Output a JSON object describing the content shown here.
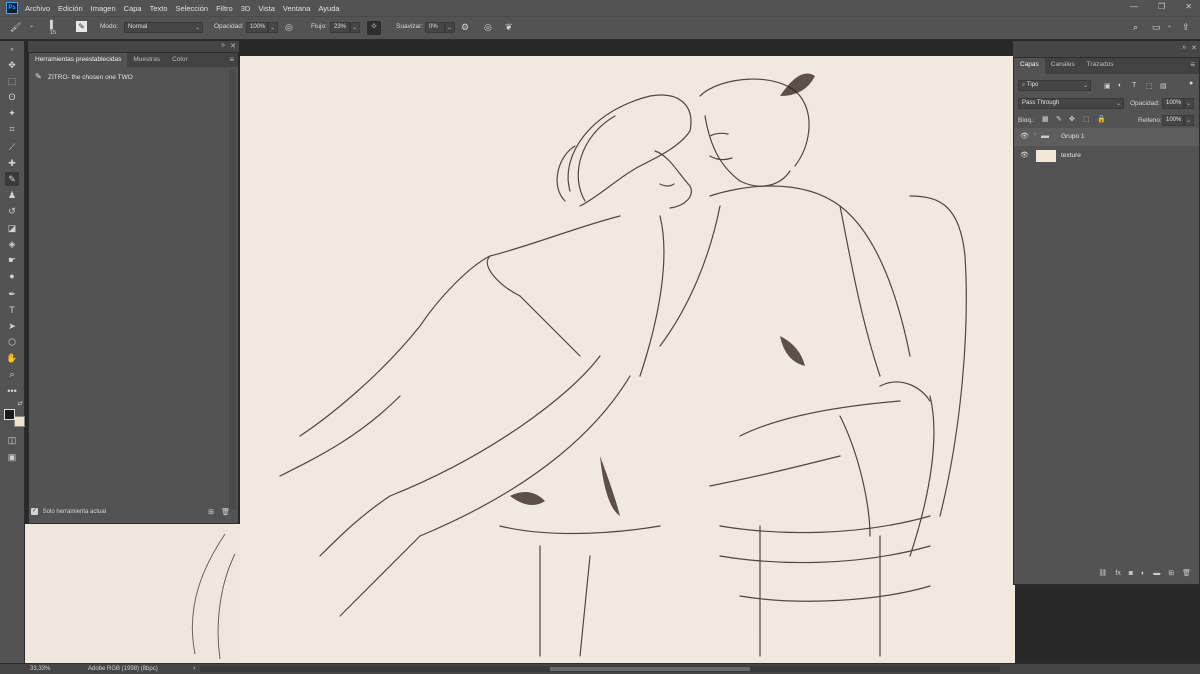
{
  "app": {
    "logo": "Ps"
  },
  "menu": [
    "Archivo",
    "Edición",
    "Imagen",
    "Capa",
    "Texto",
    "Selección",
    "Filtro",
    "3D",
    "Vista",
    "Ventana",
    "Ayuda"
  ],
  "options": {
    "brush_size": "15",
    "mode_label": "Modo:",
    "mode_value": "Normal",
    "opacity_label": "Opacidad:",
    "opacity_value": "100%",
    "flow_label": "Flujo:",
    "flow_value": "23%",
    "smoothing_label": "Suavizar:",
    "smoothing_value": "0%"
  },
  "presets_panel": {
    "tabs": [
      "Herramientas preestablecidas",
      "Muestras",
      "Color"
    ],
    "preset_item": "ZITRO- the chosen one TWO",
    "footer_label": "Solo herramienta actual"
  },
  "layers_panel": {
    "tabs": [
      "Capas",
      "Canales",
      "Trazados"
    ],
    "filter_kind": "Tipo",
    "blend_mode": "Pass Through",
    "opacity_label": "Opacidad:",
    "opacity_value": "100%",
    "lock_label": "Bloq.:",
    "fill_label": "Relleno:",
    "fill_value": "100%",
    "layers": [
      {
        "name": "Grupo 1",
        "type": "group"
      },
      {
        "name": "texture",
        "type": "layer"
      }
    ],
    "footer_icons": [
      "link-icon",
      "fx-icon",
      "mask-icon",
      "adjustment-icon",
      "folder-icon",
      "new-layer-icon",
      "trash-icon"
    ]
  },
  "status": {
    "zoom": "33,33%",
    "profile": "Adobe RGB (1998) (8bpc)"
  },
  "colors": {
    "foreground": "#1a1a1a",
    "background": "#efe4c8",
    "canvas": "#f1e9de",
    "texture_thumb": "#f4e6d8"
  }
}
